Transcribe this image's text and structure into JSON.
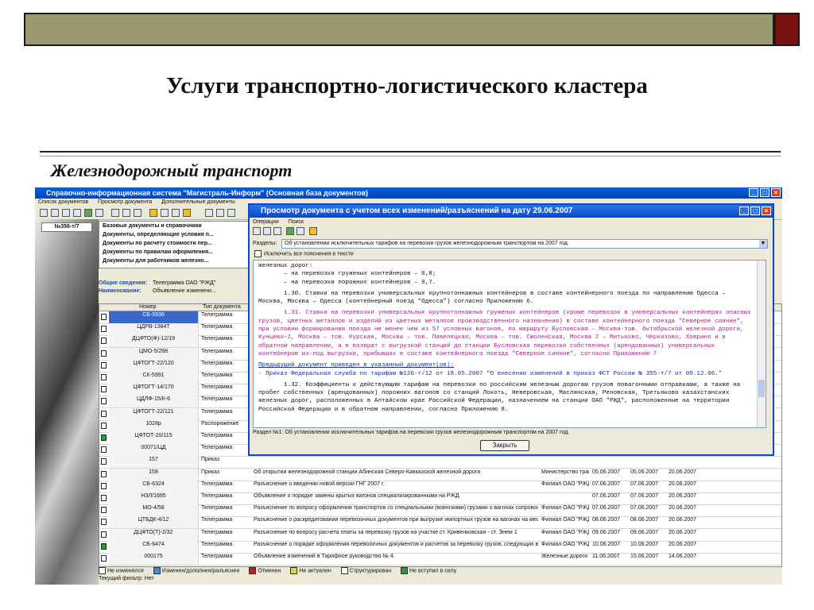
{
  "slide": {
    "title": "Услуги транспортно-логистического кластера",
    "subtitle": "Железнодорожный транспорт"
  },
  "main_window": {
    "title": "Справочно-информационная система \"Магистраль-Информ\" (Основная база документов)",
    "menu": [
      "Список документов",
      "Просмотр документа",
      "Дополнительные документы"
    ],
    "doc_number": "№356-т/7",
    "tree_items": [
      "Базовые документы и справочники",
      "Документы, определяющие условия п...",
      "Документы по расчету стоимости пер...",
      "Документы по правилам оформления...",
      "Документы для работников железно..."
    ],
    "info": {
      "general_label": "Общие сведения:",
      "general_value": "Телеграмма ОАО \"РЖД\"",
      "name_label": "Наименование:",
      "name_value": "Объявление изменени..."
    },
    "table": {
      "headers": [
        "Номер",
        "Тип документа"
      ],
      "rows": [
        {
          "num": "СБ-5936",
          "type": "Телеграмма",
          "desc": "",
          "org": "",
          "d1": "",
          "d2": "",
          "d3": ""
        },
        {
          "num": "ЦДРВ-1384Т",
          "type": "Телеграмма",
          "desc": "",
          "org": "",
          "d1": "",
          "d2": "",
          "d3": ""
        },
        {
          "num": "ДЦФТО(Ф)-12/19",
          "type": "Телеграмма",
          "desc": "",
          "org": "",
          "d1": "",
          "d2": "",
          "d3": ""
        },
        {
          "num": "ЦМО-5/268",
          "type": "Телеграмма",
          "desc": "",
          "org": "",
          "d1": "",
          "d2": "",
          "d3": ""
        },
        {
          "num": "ЦФТОГТ-22/120",
          "type": "Телеграмма",
          "desc": "",
          "org": "",
          "d1": "",
          "d2": "",
          "d3": ""
        },
        {
          "num": "СК-5991",
          "type": "Телеграмма",
          "desc": "",
          "org": "",
          "d1": "",
          "d2": "",
          "d3": ""
        },
        {
          "num": "ЦФТОГТ-14/170",
          "type": "Телеграмма",
          "desc": "",
          "org": "",
          "d1": "",
          "d2": "",
          "d3": ""
        },
        {
          "num": "ЦДЛФ-15/К-6",
          "type": "Телеграмма",
          "desc": "",
          "org": "",
          "d1": "",
          "d2": "",
          "d3": ""
        },
        {
          "num": "ЦФТОГТ-22/121",
          "type": "Телеграмма",
          "desc": "",
          "org": "",
          "d1": "",
          "d2": "",
          "d3": ""
        },
        {
          "num": "1028р",
          "type": "Распоряжение",
          "desc": "",
          "org": "",
          "d1": "",
          "d2": "",
          "d3": ""
        },
        {
          "num": "ЦФТОТ-20/115",
          "type": "Телеграмма",
          "desc": "",
          "org": "",
          "d1": "",
          "d2": "",
          "d3": ""
        },
        {
          "num": "00071/ЦД",
          "type": "Телеграмма",
          "desc": "",
          "org": "",
          "d1": "",
          "d2": "",
          "d3": ""
        },
        {
          "num": "157",
          "type": "Приказ",
          "desc": "",
          "org": "",
          "d1": "",
          "d2": "",
          "d3": ""
        },
        {
          "num": "158",
          "type": "Приказ",
          "desc": "Об открытии железнодорожной станции Абинская Северо-Кавказской железной дороги",
          "org": "Министерство транспорта РФ",
          "d1": "05.06.2007",
          "d2": "05.06.2007",
          "d3": "20.06.2007"
        },
        {
          "num": "СБ-6324",
          "type": "Телеграмма",
          "desc": "Разъяснение о введении новой версии ГНГ 2007 г.",
          "org": "Филиал ОАО \"РЖД\"",
          "d1": "07.06.2007",
          "d2": "07.06.2007",
          "d3": "20.06.2007"
        },
        {
          "num": "НЗЛ/1695",
          "type": "Телеграмма",
          "desc": "Объявление о порядке замены крытых вагонов специализированными на РЖД",
          "org": "",
          "d1": "07.06.2007",
          "d2": "07.06.2007",
          "d3": "20.06.2007"
        },
        {
          "num": "МО-4/58",
          "type": "Телеграмма",
          "desc": "Разъяснение по вопросу оформления транспортов со специальными (воинскими) грузами о вагонах сопровождения",
          "org": "Филиал ОАО \"РЖД\"",
          "d1": "07.06.2007",
          "d2": "07.06.2007",
          "d3": "20.06.2007"
        },
        {
          "num": "ЦТБДК-4/12",
          "type": "Телеграмма",
          "desc": "Разъяснение о раскредитовании перевозочных документов при выгрузке импортных грузов на вагонах на местах общего пользования в зоне таможенного контроля",
          "org": "Филиал ОАО \"РЖД\"",
          "d1": "08.06.2007",
          "d2": "08.06.2007",
          "d3": "20.06.2007"
        },
        {
          "num": "ДЦФТО(Т)-2/32",
          "type": "Телеграмма",
          "desc": "Разъяснение по вопросу расчета платы за перевозку грузов на участке ст. Кривенковская - ст. Энем 1",
          "org": "Филиал ОАО \"РЖД\"",
          "d1": "09.06.2007",
          "d2": "09.06.2007",
          "d3": "20.06.2007"
        },
        {
          "num": "СБ-6474",
          "type": "Телеграмма",
          "desc": "Разъяснение о порядке оформления перевозочных документов и расчетов за перевозку грузов, следующих в Ленском транзитном узле",
          "org": "Филиал ОАО \"РЖД\"",
          "d1": "10.06.2007",
          "d2": "10.06.2007",
          "d3": "20.06.2007"
        },
        {
          "num": "000175",
          "type": "Телеграмма",
          "desc": "Объявление изменений в Тарифное руководство № 4.",
          "org": "Железные дороги Украины",
          "d1": "11.06.2007",
          "d2": "15.06.2007",
          "d3": "14.06.2007"
        }
      ]
    },
    "legend": [
      "Не изменялся",
      "Изменен/дополнен/разъяснен",
      "Отменен",
      "Не актуален",
      "Структурирован",
      "Не вступил в силу"
    ],
    "filter": "Текущий фильтр: Нет"
  },
  "popup": {
    "title": "Просмотр документа с учетом всех изменений/разъяснений на дату 29.06.2007",
    "menu": [
      "Операции",
      "Поиск"
    ],
    "section_label": "Разделы:",
    "section_value": "Об установлении исключительных тарифов на перевозки грузов железнодорожным транспортом на 2007 год.",
    "exclude_label": "Исключить все пояснения в тексте",
    "text": {
      "p1": "железных дорог:",
      "p2": "– на перевозки груженых контейнеров – 0,8;",
      "p3": "– на перевозки порожних контейнеров – 0,7.",
      "p4": "1.30. Ставки на перевозки универсальных крупнотоннажных контейнеров в составе контейнерного поезда по направлению Одесса – Москва, Москва – Одесса (контейнерный поезд \"Одесса\") согласно Приложению 6.",
      "p5": "1.31. Ставки на перевозки универсальных крупнотоннажных груженых контейнеров (кроме перевозок в универсальных контейнерах опасных грузов, цветных металлов и изделий из цветных металлов производственного назначения) в составе контейнерного поезда \"Северное сияние\", при условии формирования поезда не менее чем из 57 условных вагонов, по маршруту Бусловская – Москва-тов. Октябрьской железной дороги, Кунцево-2, Москва – тов. Курская, Москва – тов. Павелецкая, Москва – тов. Смоленская, Москва 2 – Митьково, Черкизово, Ховрино и в обратном направлении, а в возврат с выгрузкой станций до станции Бусловская перевозки собственных (арендованных) универсальных контейнеров из-под выгрузки, прибывших в составе контейнерного поезда \"Северное сияние\", согласно Приложению 7",
      "p6": "Предыдущий документ приведен в указанный документ(ов):",
      "p7": "- Приказ Федеральная служба по тарифам №126-т/12 от 18.05.2007 \"О внесении изменений в приказ ФСТ России № 355-т/7 от 09.12.06.\"",
      "p8": "1.32. Коэффициенты к действующим тарифам на перевозки по российским железным дорогам грузов повагонными отправками, а также на пробег собственных (арендованных) порожних вагонов со станций Локоть, Неверовская, Маслянская, Реновская, Третьяково казахстанских железных дорог, расположенных в Алтайском крае Российской Федерации, назначением на станции ОАО \"РЖД\", расположенные на территории Российской Федерации и в обратном направлении, согласно Приложению 8."
    },
    "status": "Раздел №1: Об установлении исключительных тарифов на перевозки грузов железнодорожным транспортом на 2007 год.",
    "close_label": "Закрыть"
  }
}
